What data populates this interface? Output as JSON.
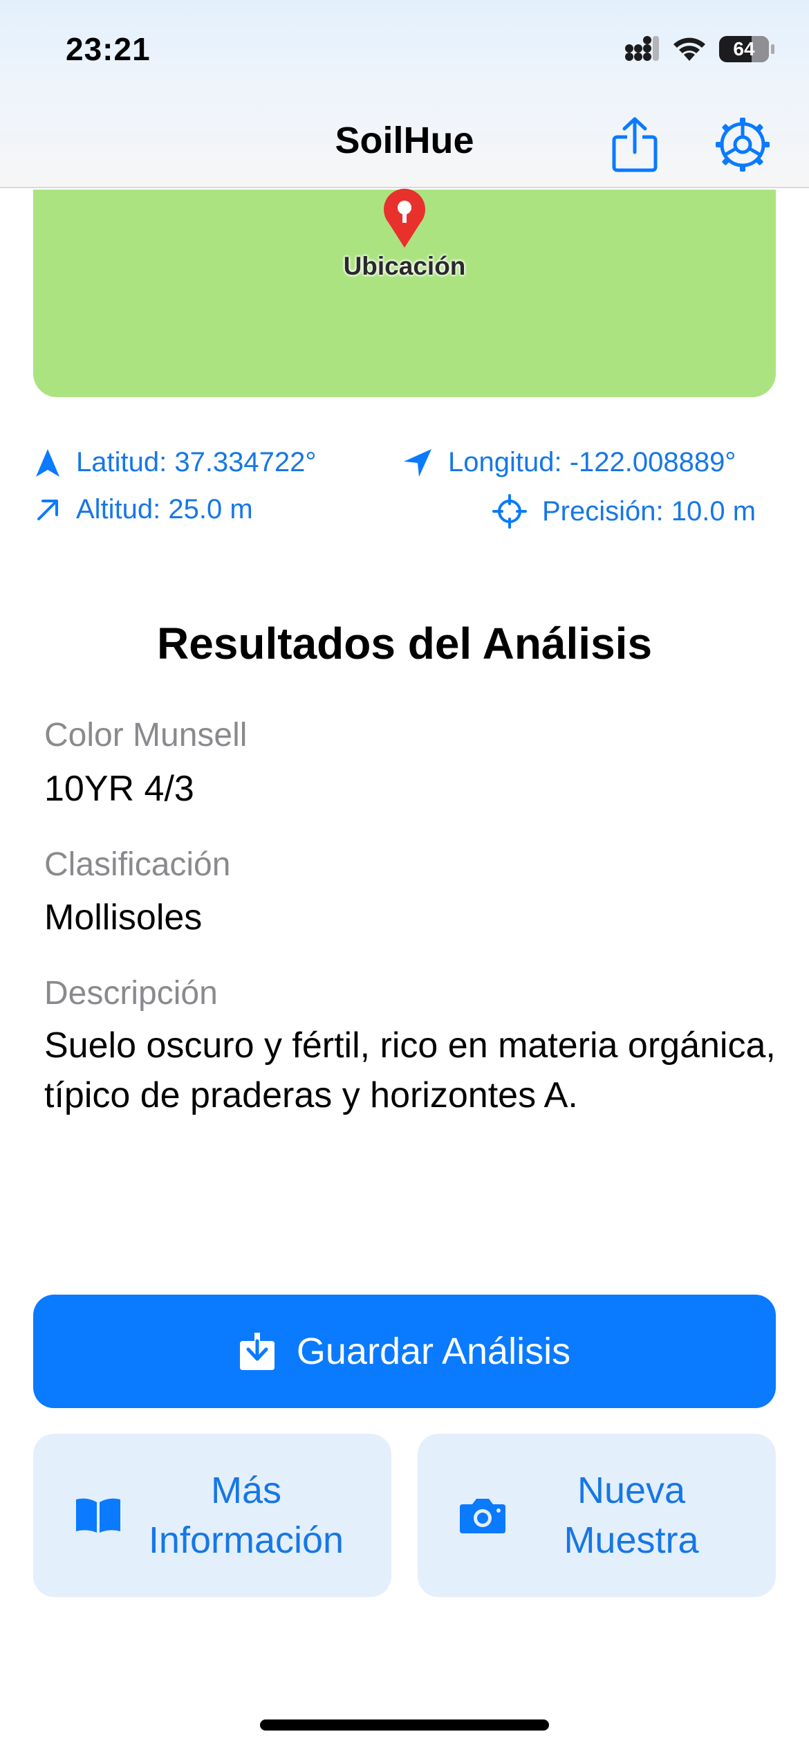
{
  "status_bar": {
    "time": "23:21",
    "battery": "64"
  },
  "nav": {
    "title": "SoilHue",
    "share_icon": "share-icon",
    "settings_icon": "gear-icon"
  },
  "map": {
    "pin_label": "Ubicación",
    "background_color": "#ace381"
  },
  "location": {
    "latitude": "Latitud: 37.334722°",
    "longitude": "Longitud: -122.008889°",
    "altitude": "Altitud: 25.0 m",
    "precision": "Precisión: 10.0 m"
  },
  "results": {
    "title": "Resultados del Análisis",
    "munsell_label": "Color Munsell",
    "munsell_value": "10YR 4/3",
    "classification_label": "Clasificación",
    "classification_value": "Mollisoles",
    "description_label": "Descripción",
    "description_value": "Suelo oscuro y fértil, rico en materia orgánica, típico de praderas y horizontes A."
  },
  "actions": {
    "save_label": "Guardar Análisis",
    "more_info_line1": "Más",
    "more_info_line2": "Información",
    "new_sample_line1": "Nueva",
    "new_sample_line2": "Muestra"
  },
  "colors": {
    "accent": "#0a7aff",
    "secondary_bg": "#e4effc"
  }
}
